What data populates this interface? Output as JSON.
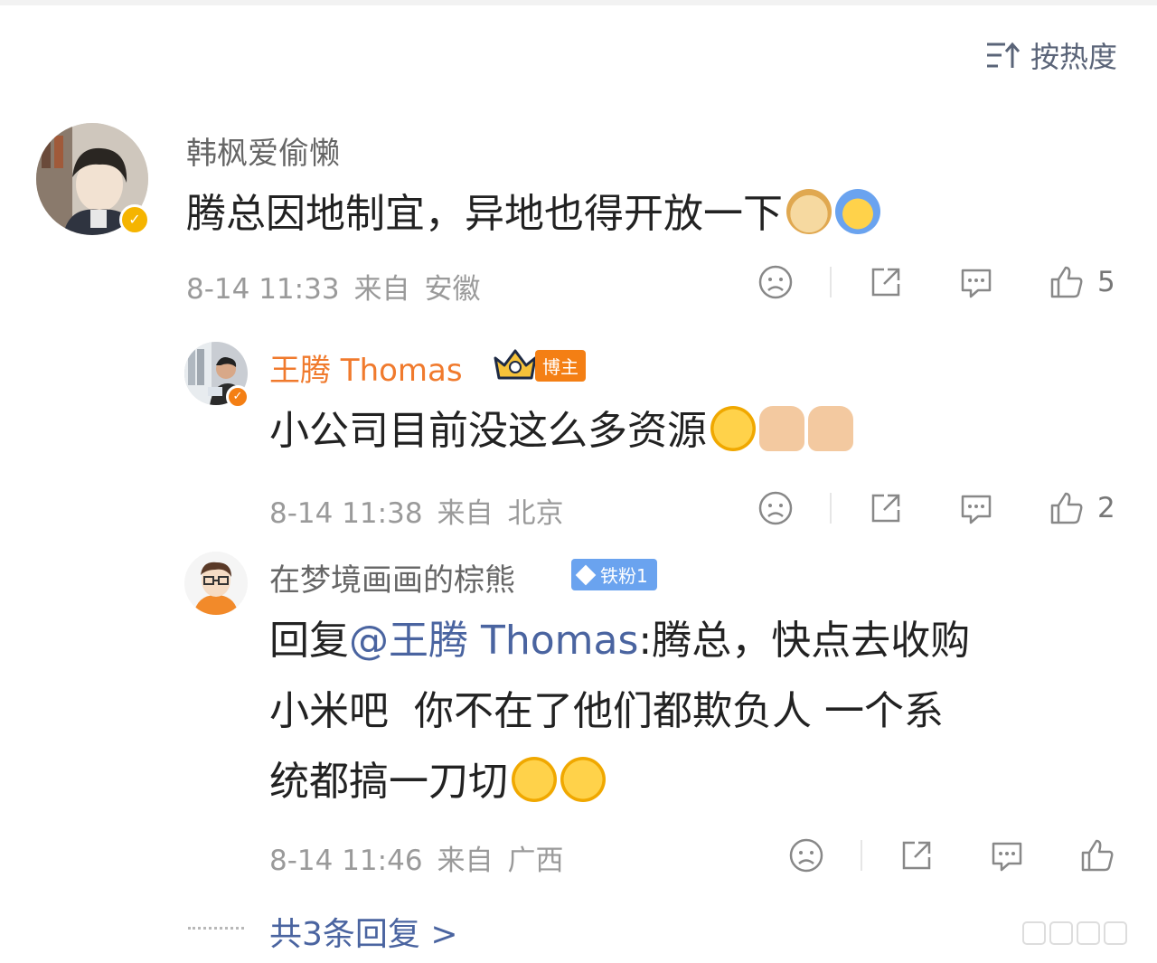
{
  "sort": {
    "label": "按热度"
  },
  "comments": [
    {
      "name": "韩枫爱偷懒",
      "text": "腾总因地制宜，异地也得开放一下",
      "time": "8-14 11:33",
      "from": "来自",
      "location": "安徽",
      "likes": "5"
    },
    {
      "name": "王腾 Thomas",
      "badge": "博主",
      "text": "小公司目前没这么多资源",
      "time": "8-14 11:38",
      "from": "来自",
      "location": "北京",
      "likes": "2"
    },
    {
      "name": "在梦境画画的棕熊",
      "badge": "铁粉1",
      "reply_prefix": "回复",
      "mention": "@王腾 Thomas",
      "text_line1": ":腾总，快点去收购",
      "text_line2": "小米吧  你不在了他们都欺负人 一个系",
      "text_line3": "统都搞一刀切",
      "time": "8-14 11:46",
      "from": "来自",
      "location": "广西",
      "likes": ""
    }
  ],
  "more_replies": "共3条回复 >",
  "colors": {
    "link": "#4a64a0",
    "blogger": "#f07a2d",
    "verified": "#f5b400"
  }
}
